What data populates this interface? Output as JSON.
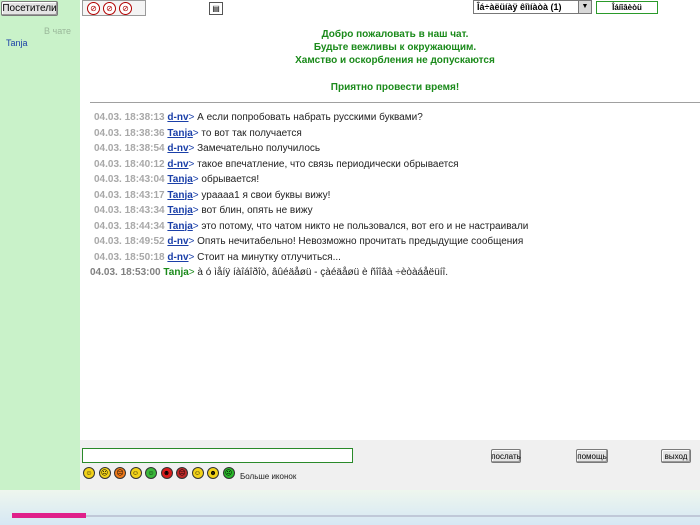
{
  "sidebar": {
    "visitors_button": "Посетители",
    "in_chat_label": "В чате",
    "users": [
      "Tanja"
    ]
  },
  "toolbar": {
    "room_select": "Îá÷àëüíàÿ êîìíàòà (1)",
    "refresh_button": "Îáíîâèòü",
    "tool_icons": [
      "no-entry-icon",
      "no-smoking-icon",
      "block-icon",
      "notepad-icon"
    ]
  },
  "welcome": {
    "line1": "Добро пожаловать в наш чат.",
    "line2": "Будьте вежливы к окружающим.",
    "line3": "Хамство и оскорбления не допускаются",
    "line4": "Приятно провести время!"
  },
  "messages": [
    {
      "ts": "04.03. 18:38:13",
      "nick": "d-nv",
      "text": "А если попробовать набрать русскими буквами?"
    },
    {
      "ts": "04.03. 18:38:36",
      "nick": "Tanja",
      "text": "то вот так получается"
    },
    {
      "ts": "04.03. 18:38:54",
      "nick": "d-nv",
      "text": "Замечательно получилось"
    },
    {
      "ts": "04.03. 18:40:12",
      "nick": "d-nv",
      "text": "такое впечатление, что связь периодически обрывается"
    },
    {
      "ts": "04.03. 18:43:04",
      "nick": "Tanja",
      "text": "обрывается!"
    },
    {
      "ts": "04.03. 18:43:17",
      "nick": "Tanja",
      "text": "урaaaa1 я свои буквы вижу!"
    },
    {
      "ts": "04.03. 18:43:34",
      "nick": "Tanja",
      "text": "вот блин, опять не вижу"
    },
    {
      "ts": "04.03. 18:44:34",
      "nick": "Tanja",
      "text": "это потому, что чатом никто не пользовался, вот его и не настраивали"
    },
    {
      "ts": "04.03. 18:49:52",
      "nick": "d-nv",
      "text": "Опять нечитабельно! Невозможно прочитать предыдущие сообщения"
    },
    {
      "ts": "04.03. 18:50:18",
      "nick": "d-nv",
      "text": "Стоит на минутку отлучиться..."
    },
    {
      "ts": "04.03. 18:53:00",
      "nick": "Tanja",
      "text": "à ó ìåíÿ íàîáîðîò, âûéäåøü - çàéäåøü è ñîîâà ÷èòàáåëüíî."
    }
  ],
  "input": {
    "value": "",
    "send_button": "послать",
    "help_button": "помощь",
    "exit_button": "выход"
  },
  "smileys": [
    {
      "name": "smile-icon",
      "color": "#f2d21a",
      "glyph": "☺"
    },
    {
      "name": "sad-icon",
      "color": "#f2d21a",
      "glyph": "☹"
    },
    {
      "name": "angry-icon",
      "color": "#f07a1a",
      "glyph": "☹"
    },
    {
      "name": "grin-icon",
      "color": "#f2d21a",
      "glyph": "☺"
    },
    {
      "name": "tongue-icon",
      "color": "#3ab83a",
      "glyph": "☺"
    },
    {
      "name": "devil-icon",
      "color": "#d81a1a",
      "glyph": "☻"
    },
    {
      "name": "mad-icon",
      "color": "#c02a2a",
      "glyph": "☹"
    },
    {
      "name": "wink-icon",
      "color": "#f2d21a",
      "glyph": "☺"
    },
    {
      "name": "cool-icon",
      "color": "#f2d21a",
      "glyph": "☻"
    },
    {
      "name": "sick-icon",
      "color": "#2ab82a",
      "glyph": "☹"
    }
  ],
  "more_icons_label": "Больше иконок"
}
